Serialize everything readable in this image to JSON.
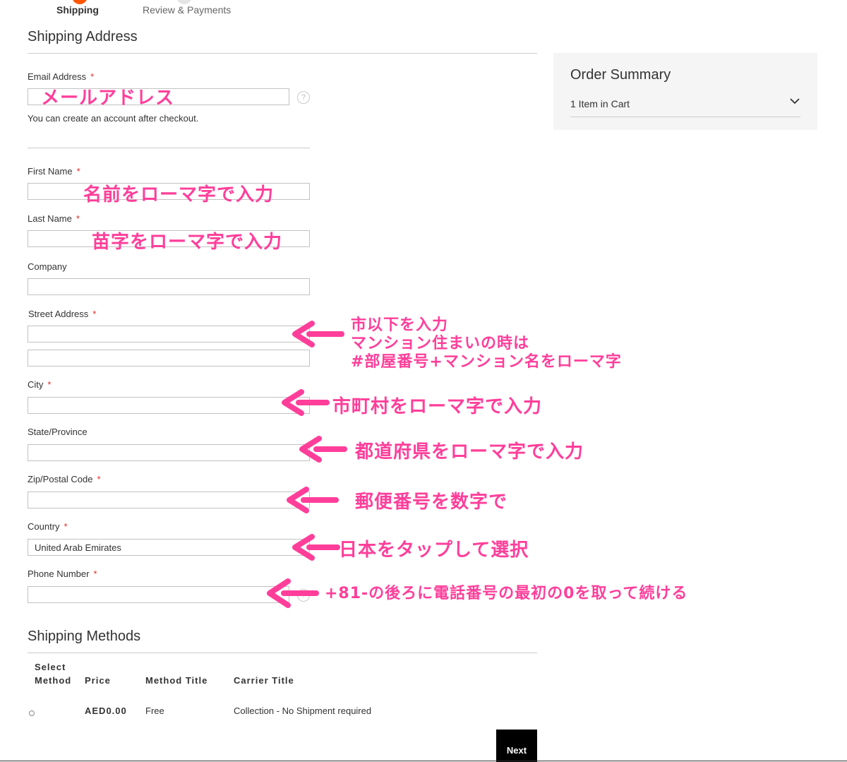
{
  "progress": {
    "steps": [
      {
        "label": "Shipping"
      },
      {
        "label": "Review & Payments"
      }
    ]
  },
  "shipping_address": {
    "title": "Shipping Address",
    "email": {
      "label": "Email Address",
      "value": "メールアドレス",
      "note": "You can create an account after checkout.",
      "help": "?"
    },
    "first_name": {
      "label": "First Name",
      "value": "名前をローマ字で入力"
    },
    "last_name": {
      "label": "Last Name",
      "value": "苗字をローマ字で入力"
    },
    "company": {
      "label": "Company",
      "value": ""
    },
    "street": {
      "label": "Street Address",
      "value1": "",
      "value2": ""
    },
    "city": {
      "label": "City",
      "value": ""
    },
    "state": {
      "label": "State/Province",
      "value": ""
    },
    "zip": {
      "label": "Zip/Postal Code",
      "value": ""
    },
    "country": {
      "label": "Country",
      "value": "United Arab Emirates"
    },
    "phone": {
      "label": "Phone Number",
      "value": "",
      "help": "?"
    },
    "required_mark": "*"
  },
  "annotations": {
    "street_line1": "市以下を入力",
    "street_line2": "マンション住まいの時は",
    "street_line3": "#部屋番号+マンション名をローマ字",
    "city": "市町村をローマ字で入力",
    "state": "都道府県をローマ字で入力",
    "zip": "郵便番号を数字で",
    "country": "日本をタップして選択",
    "phone": "+81-の後ろに電話番号の最初の0を取って続ける",
    "color": "#ff3e9a"
  },
  "order_summary": {
    "title": "Order Summary",
    "items_in_cart": "1 Item in Cart"
  },
  "shipping_methods": {
    "title": "Shipping Methods",
    "headers": {
      "select_1": "Select",
      "select_2": "Method",
      "price": "Price",
      "method_title": "Method Title",
      "carrier_title": "Carrier Title"
    },
    "rows": [
      {
        "price": "AED0.00",
        "method_title": "Free",
        "carrier_title": "Collection - No Shipment required"
      }
    ]
  },
  "actions": {
    "next_label": "Next"
  },
  "colors": {
    "accent": "#ff5501",
    "required": "#e02b27",
    "annotation": "#ff3e9a",
    "button": "#000000"
  }
}
